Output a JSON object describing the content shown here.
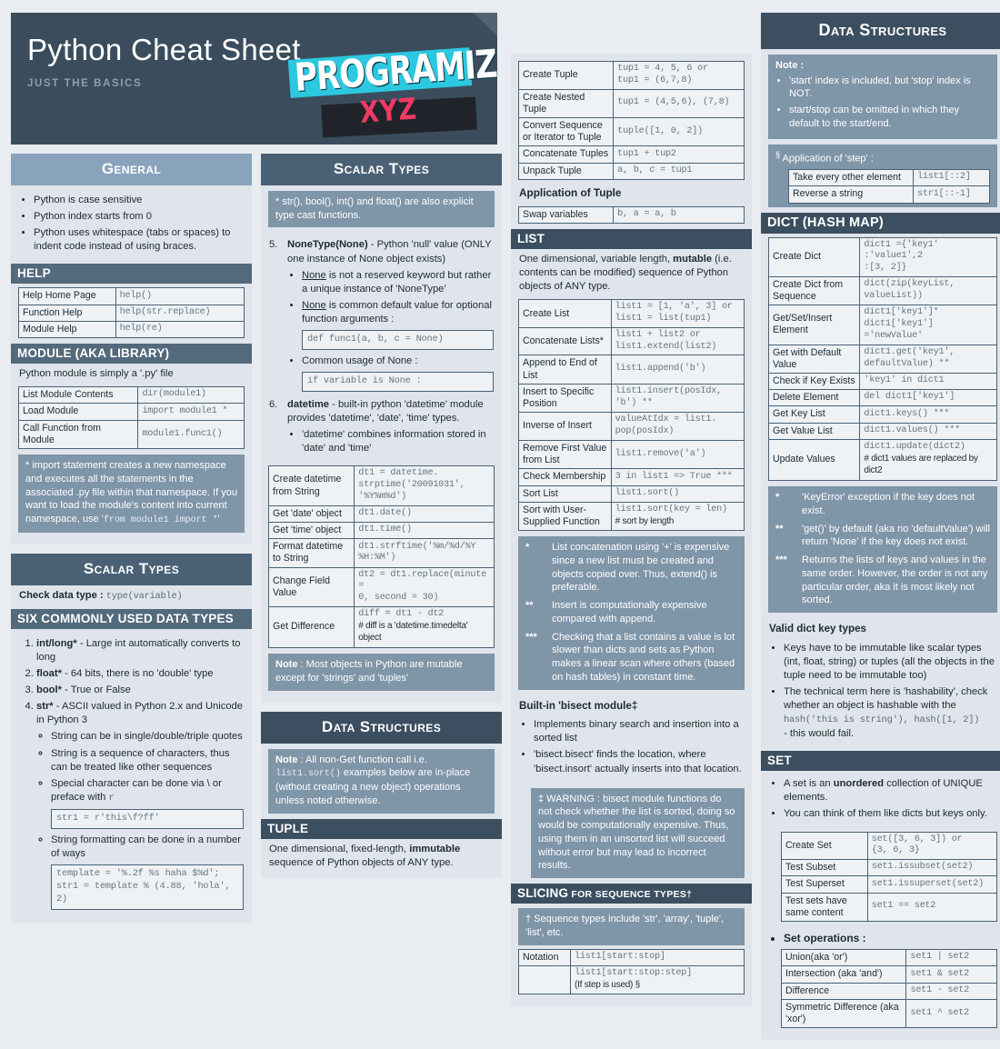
{
  "banner": {
    "title": "Python Cheat Sheet",
    "subtitle": "JUST THE BASICS",
    "brand": "PROGRAMIZ.",
    "brand_tld": "XYZ"
  },
  "general": {
    "heading": "General",
    "bullets": [
      "Python is case sensitive",
      "Python index starts from 0",
      "Python uses whitespace (tabs or spaces) to indent code instead of using braces."
    ],
    "help": {
      "heading": "HELP",
      "rows": [
        {
          "label": "Help Home Page",
          "code": "help()"
        },
        {
          "label": "Function Help",
          "code": "help(str.replace)"
        },
        {
          "label": "Module Help",
          "code": "help(re)"
        }
      ]
    },
    "module": {
      "heading": "MODULE (AKA LIBRARY)",
      "intro": "Python module is simply a '.py' file",
      "rows": [
        {
          "label": "List Module Contents",
          "code": "dir(module1)"
        },
        {
          "label": "Load Module",
          "code": "import module1 *"
        },
        {
          "label": "Call Function from Module",
          "code": "module1.func1()"
        }
      ],
      "note_text": "* import statement creates a new namespace and executes all the statements in the associated .py file within that namespace. If you want to load the module's content into current namespace, use '",
      "note_code": "from module1 import *",
      "note_tail": "'"
    }
  },
  "scalar_left": {
    "heading": "Scalar Types",
    "check_label": "Check data type :",
    "check_code": "type(variable)",
    "six_heading": "SIX COMMONLY USED DATA TYPES",
    "items": [
      {
        "term": "int/long*",
        "desc": " - Large int automatically converts to long"
      },
      {
        "term": "float*",
        "desc": " - 64 bits, there is no 'double' type"
      },
      {
        "term": "bool*",
        "desc": " - True or False"
      },
      {
        "term": "str*",
        "desc": " - ASCII valued in Python 2.x and Unicode in Python 3"
      }
    ],
    "str_bullets": [
      "String can be in single/double/triple quotes",
      "String is a sequence of characters, thus can be treated like other sequences"
    ],
    "special_char": "Special character can be done via \\ or preface with",
    "special_char_mono": "r",
    "code_special": "str1 = r'this\\f?ff'",
    "formatting": "String formatting can be done in a number of ways",
    "code_format_1": "template = '%.2f %s haha $%d';",
    "code_format_2": "str1 = template % (4.88, 'hola', 2)"
  },
  "scalar_right": {
    "heading": "Scalar Types",
    "note_star": "* str(), bool(), int() and float() are also explicit type cast functions.",
    "item5_num": "5.",
    "item5_term": "NoneType(None)",
    "item5_desc": " - Python 'null' value (ONLY one instance of None object exists)",
    "none_b1_pre": "None",
    "none_b1": " is not a reserved keyword but rather a unique instance of 'NoneType'",
    "none_b2_pre": "None",
    "none_b2": " is common default value for optional function arguments :",
    "code_func": "def func1(a, b, c = None)",
    "common_usage": "Common usage of None :",
    "code_isnone": "if variable is None :",
    "item6_num": "6.",
    "item6_term": "datetime",
    "item6_desc": " - built-in python 'datetime' module provides 'datetime', 'date', 'time' types.",
    "dt_bullet": "'datetime' combines information stored in 'date' and 'time'",
    "rows": [
      {
        "label": "Create datetime from String",
        "code": "dt1 = datetime.\nstrptime('20091031',\n'%Y%m%d')"
      },
      {
        "label": "Get 'date' object",
        "code": "dt1.date()"
      },
      {
        "label": "Get 'time' object",
        "code": "dt1.time()"
      },
      {
        "label": "Format datetime to String",
        "code": "dt1.strftime('%m/%d/%Y\n%H:%M')"
      },
      {
        "label": "Change Field Value",
        "code": "dt2 = dt1.replace(minute =\n0,  second = 30)"
      },
      {
        "label": "Get Difference",
        "code": "diff = dt1 - dt2",
        "comment": "# diff is a 'datetime.timedelta' object"
      }
    ],
    "note_bold": "Note",
    "note_text": " : Most objects in Python are mutable except for 'strings' and 'tuples'"
  },
  "ds_left": {
    "heading": "Data Structures",
    "note_bold": "Note",
    "note_pre": " : All non-Get function call i.e. ",
    "note_code": "list1.sort()",
    "note_post": " examples below are in-place (without creating a new object) operations unless noted otherwise.",
    "tuple_heading": "TUPLE",
    "tuple_desc_pre": "One dimensional, fixed-length, ",
    "tuple_desc_bold": "immutable",
    "tuple_desc_post": " sequence of Python objects of ANY type."
  },
  "ds_right": {
    "heading": "Data Structures",
    "tuple_rows": [
      {
        "label": "Create Tuple",
        "code": "tup1 = 4, 5, 6 or\ntup1 = (6,7,8)"
      },
      {
        "label": "Create Nested Tuple",
        "code": "tup1 = (4,5,6), (7,8)"
      },
      {
        "label": "Convert Sequence or Iterator to Tuple",
        "code": "tuple([1, 0, 2])"
      },
      {
        "label": "Concatenate Tuples",
        "code": "tup1 + tup2"
      },
      {
        "label": "Unpack Tuple",
        "code": "a, b, c = tup1"
      }
    ],
    "application_title": "Application of Tuple",
    "application_rows": [
      {
        "label": "Swap variables",
        "code": "b, a = a, b"
      }
    ],
    "list_heading": "LIST",
    "list_desc_pre": "One dimensional, variable length, ",
    "list_desc_bold": "mutable",
    "list_desc_post": " (i.e. contents can be modified) sequence of Python objects of ANY type.",
    "list_rows": [
      {
        "label": "Create List",
        "code": "list1 = [1, 'a', 3] or\nlist1 = list(tup1)"
      },
      {
        "label": "Concatenate Lists*",
        "code": "list1 + list2 or\nlist1.extend(list2)"
      },
      {
        "label": "Append to End of List",
        "code": "list1.append('b')"
      },
      {
        "label": "Insert to Specific Position",
        "code": "list1.insert(posIdx,\n'b') **"
      },
      {
        "label": "Inverse of Insert",
        "code": "valueAtIdx = list1.\npop(posIdx)"
      },
      {
        "label": "Remove First Value from List",
        "code": "list1.remove('a')"
      },
      {
        "label": "Check Membership",
        "code": "3 in list1 => True ***"
      },
      {
        "label": "Sort List",
        "code": "list1.sort()"
      },
      {
        "label": "Sort with User-Supplied Function",
        "code": "list1.sort(key = len)",
        "comment": "# sort by length"
      }
    ],
    "footnotes": [
      {
        "mark": "*",
        "text": "List concatenation using '+' is expensive since a new list must be created and objects copied over. Thus, extend() is preferable."
      },
      {
        "mark": "**",
        "text": "Insert is computationally expensive compared with append."
      },
      {
        "mark": "***",
        "text": "Checking that a list contains a value is lot slower than dicts and sets as Python makes a linear scan where others (based on hash tables) in constant time."
      }
    ],
    "bisect_title": "Built-in 'bisect module‡",
    "bisect_bullets": [
      "Implements binary search and insertion into a sorted list",
      "'bisect.bisect' finds the location, where 'bisect.insort' actually inserts into that location."
    ],
    "warning": "‡ WARNING : bisect module functions do not check whether the list is sorted, doing so would be computationally expensive. Thus, using them in an unsorted list will succeed without error but may lead to incorrect results.",
    "slicing_heading": "SLICING",
    "slicing_heading_small": " FOR SEQUENCE TYPES†",
    "slicing_note": "† Sequence types include 'str', 'array', 'tuple', 'list', etc.",
    "slicing_rows": [
      {
        "label": "Notation",
        "code": "list1[start:stop]"
      },
      {
        "label": "",
        "code": "list1[start:stop:step]",
        "comment": "(If step is used) §"
      }
    ]
  },
  "right_col": {
    "note_title": "Note :",
    "note_bullets": [
      "'start' index is included, but 'stop' index is NOT.",
      "start/stop can be omitted in which they default to the start/end."
    ],
    "step_title_sup": "§",
    "step_title": " Application of 'step' :",
    "step_rows": [
      {
        "label": "Take every other element",
        "code": "list1[::2]"
      },
      {
        "label": "Reverse a string",
        "code": "str1[::-1]"
      }
    ],
    "dict_heading": "DICT (HASH MAP)",
    "dict_rows": [
      {
        "label": "Create Dict",
        "code": "dict1 ={'key1' :'value1',2\n:[3, 2]}"
      },
      {
        "label": "Create Dict from Sequence",
        "code": "dict(zip(keyList,\nvalueList))"
      },
      {
        "label": "Get/Set/Insert Element",
        "code": "dict1['key1']*\ndict1['key1'] ='newValue'"
      },
      {
        "label": "Get with Default Value",
        "code": "dict1.get('key1',\ndefaultValue) **"
      },
      {
        "label": "Check if Key Exists",
        "code": "'key1' in dict1"
      },
      {
        "label": "Delete Element",
        "code": "del dict1['key1']"
      },
      {
        "label": "Get Key List",
        "code": "dict1.keys() ***"
      },
      {
        "label": "Get Value List",
        "code": "dict1.values() ***"
      },
      {
        "label": "Update Values",
        "code": "dict1.update(dict2)",
        "comment": "# dict1 values are replaced by dict2"
      }
    ],
    "dict_footnotes": [
      {
        "mark": "*",
        "text": "'KeyError' exception if the key does not exist."
      },
      {
        "mark": "**",
        "text": "'get()' by default (aka no 'defaultValue') will return 'None' if the key does not exist."
      },
      {
        "mark": "***",
        "text": "Returns the lists of keys and values in the same order. However, the order is not any particular order, aka it is most likely not sorted."
      }
    ],
    "valid_keys_title": "Valid dict key types",
    "valid_keys_bullets": [
      "Keys have to be immutable like scalar types (int, float, string) or tuples (all the objects in the tuple need to be immutable too)"
    ],
    "hashability_text": "The technical term here is 'hashability', check whether an object is hashable with the",
    "hashability_code": "hash('this is string'), hash([1, 2])",
    "hashability_tail": "- this would fail.",
    "set_heading": "SET",
    "set_bullets": [
      "A set is an unordered collection of UNIQUE elements.",
      "You can think of them like dicts but keys only."
    ],
    "set_rows": [
      {
        "label": "Create Set",
        "code": "set([3, 6, 3]) or\n{3, 6, 3}"
      },
      {
        "label": "Test Subset",
        "code": "set1.issubset(set2)"
      },
      {
        "label": "Test Superset",
        "code": "set1.issuperset(set2)"
      },
      {
        "label": "Test sets have same content",
        "code": "set1 == set2"
      }
    ],
    "set_ops_title": "Set operations :",
    "set_ops_rows": [
      {
        "label": "Union(aka 'or')",
        "code": "set1 | set2"
      },
      {
        "label": "Intersection (aka 'and')",
        "code": "set1 & set2"
      },
      {
        "label": "Difference",
        "code": "set1 - set2"
      },
      {
        "label": "Symmetric Difference (aka 'xor')",
        "code": "set1 ^ set2"
      }
    ]
  },
  "colors": {
    "page_bg": "#e9ecf0",
    "banner_bg": "#3b4d5d",
    "head_light": "#8aa3bd",
    "head_mid": "#4a6175",
    "head_dark": "#3c4f60",
    "note_bg": "#7f95a8",
    "card_bg": "#dfe5ea",
    "accent_cyan": "#2cc8e0",
    "accent_pink": "#ef3a63"
  }
}
